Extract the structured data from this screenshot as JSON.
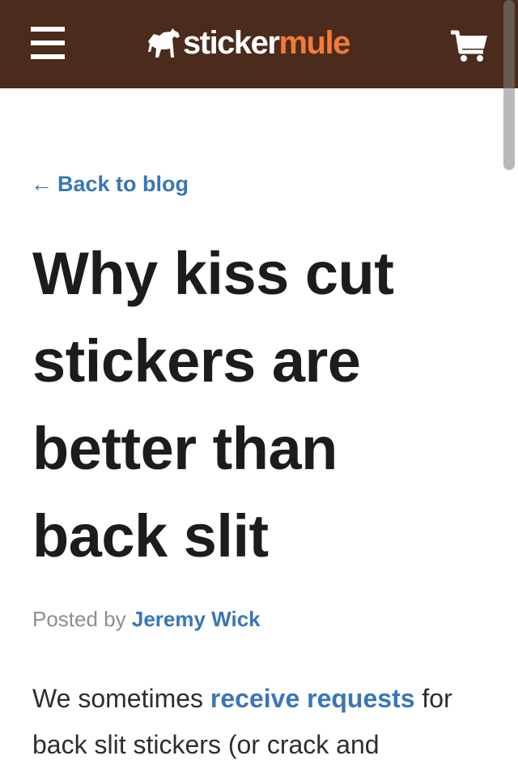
{
  "header": {
    "logo": {
      "part1": "sticker",
      "part2": "mule",
      "icon": "horse-logo-icon"
    },
    "menu_icon": "hamburger-menu-icon",
    "cart_icon": "shopping-cart-icon",
    "background_color": "#4a2b1c",
    "accent_color": "#f37b37"
  },
  "nav": {
    "back_arrow": "←",
    "back_label": "Back to blog"
  },
  "article": {
    "title": "Why kiss cut stickers are better than back slit",
    "byline_prefix": "Posted by",
    "author": "Jeremy Wick",
    "intro_before_link": "We sometimes",
    "intro_link": "receive requests",
    "intro_after_link": "for back slit stickers (or crack and"
  },
  "colors": {
    "link": "#3a76b6",
    "title": "#1c1c1c",
    "muted": "#8e8e8e"
  }
}
